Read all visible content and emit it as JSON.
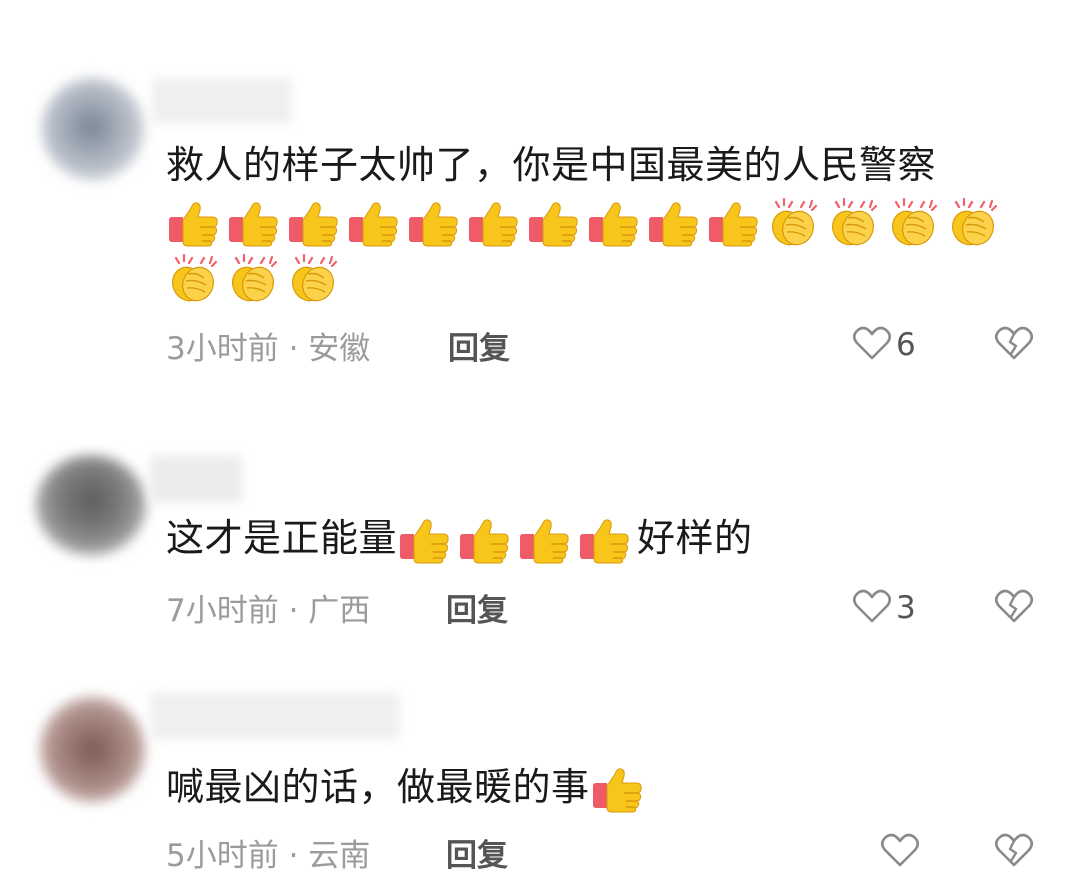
{
  "comments": [
    {
      "text": "救人的样子太帅了，你是中国最美的人民警察",
      "emojis": [
        "thumbs-up",
        "thumbs-up",
        "thumbs-up",
        "thumbs-up",
        "thumbs-up",
        "thumbs-up",
        "thumbs-up",
        "thumbs-up",
        "thumbs-up",
        "thumbs-up",
        "clapping-hands",
        "clapping-hands",
        "clapping-hands",
        "clapping-hands",
        "clapping-hands",
        "clapping-hands",
        "clapping-hands"
      ],
      "time": "3小时前 · 安徽",
      "reply": "回复",
      "likes": "6"
    },
    {
      "text_before": "这才是正能量",
      "emojis": [
        "thumbs-up",
        "thumbs-up",
        "thumbs-up",
        "thumbs-up"
      ],
      "text_after": "好样的",
      "time": "7小时前 · 广西",
      "reply": "回复",
      "likes": "3"
    },
    {
      "text_before": "喊最凶的话，做最暖的事",
      "emojis": [
        "thumbs-up"
      ],
      "time": "5小时前 · 云南",
      "reply": "回复",
      "likes": ""
    }
  ],
  "colors": {
    "text": "#1a1a1a",
    "meta": "#9b9b9b",
    "reply": "#555555",
    "icon": "#8a8a8a"
  }
}
